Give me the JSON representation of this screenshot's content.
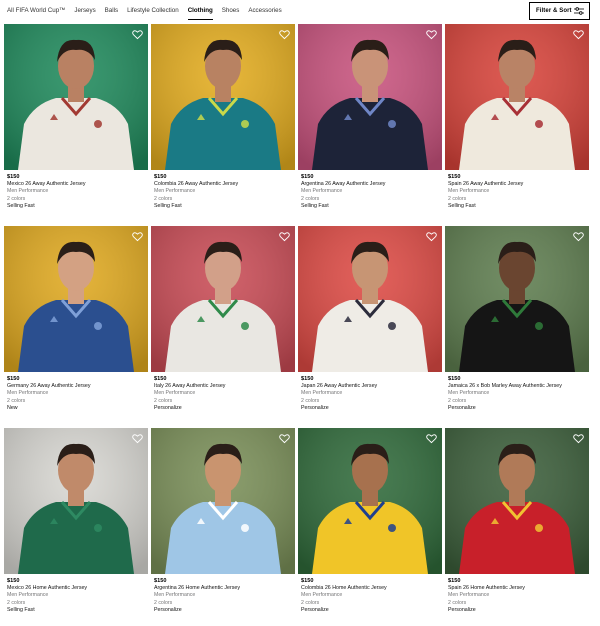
{
  "tabs": [
    {
      "label": "All FIFA World Cup™",
      "active": false
    },
    {
      "label": "Jerseys",
      "active": false
    },
    {
      "label": "Balls",
      "active": false
    },
    {
      "label": "Lifestyle Collection",
      "active": false
    },
    {
      "label": "Clothing",
      "active": true
    },
    {
      "label": "Shoes",
      "active": false
    },
    {
      "label": "Accessories",
      "active": false
    }
  ],
  "filter": {
    "label": "Filter & Sort",
    "icon": "sliders-icon"
  },
  "products": [
    {
      "price": "$150",
      "name": "Mexico 26 Away Authentic Jersey",
      "category": "Men Performance",
      "colors": "2 colors",
      "badge": "Selling Fast",
      "bg": "#1f8a5c",
      "shirt": "#ebe7df",
      "trim": "#a23a33",
      "skin": "#b98163"
    },
    {
      "price": "$150",
      "name": "Colombia 26 Away Authentic Jersey",
      "category": "Men Performance",
      "colors": "2 colors",
      "badge": "Selling Fast",
      "bg": "#e3ac1e",
      "shirt": "#1a7a85",
      "trim": "#c9d94a",
      "skin": "#b88262"
    },
    {
      "price": "$150",
      "name": "Argentina 26 Away Authentic Jersey",
      "category": "Men Performance",
      "colors": "2 colors",
      "badge": "Selling Fast",
      "bg": "#c8527d",
      "shirt": "#1d2338",
      "trim": "#6f86c6",
      "skin": "#c99378"
    },
    {
      "price": "$150",
      "name": "Spain 26 Away Authentic Jersey",
      "category": "Men Performance",
      "colors": "2 colors",
      "badge": "Selling Fast",
      "bg": "#d8433a",
      "shirt": "#efe9dd",
      "trim": "#a83036",
      "skin": "#b98366"
    },
    {
      "price": "$150",
      "name": "Germany 26 Away Authentic Jersey",
      "category": "Men Performance",
      "colors": "2 colors",
      "badge": "New",
      "bg": "#e0a91f",
      "shirt": "#2b4f8f",
      "trim": "#7fa0d8",
      "skin": "#d3a183"
    },
    {
      "price": "$150",
      "name": "Italy 26 Away Authentic Jersey",
      "category": "Men Performance",
      "colors": "2 colors",
      "badge": "Personalize",
      "bg": "#c94b55",
      "shirt": "#e9e7e2",
      "trim": "#2f8a4a",
      "skin": "#d2a089"
    },
    {
      "price": "$150",
      "name": "Japan 26 Away Authentic Jersey",
      "category": "Men Performance",
      "colors": "2 colors",
      "badge": "Personalize",
      "bg": "#de4a44",
      "shirt": "#efece6",
      "trim": "#2c2c3c",
      "skin": "#c79574"
    },
    {
      "price": "$150",
      "name": "Jamaica 26 x Bob Marley Away Authentic Jersey",
      "category": "Men Performance",
      "colors": "2 colors",
      "badge": "Personalize",
      "bg": "#5e7d4f",
      "shirt": "#151515",
      "trim": "#2f7a3a",
      "skin": "#6a4530"
    },
    {
      "price": "$150",
      "name": "Mexico 26 Home Authentic Jersey",
      "category": "Men Performance",
      "colors": "2 colors",
      "badge": "Selling Fast",
      "bg": "#d8d7d2",
      "shirt": "#1f6a4b",
      "trim": "#2e8a62",
      "skin": "#c08a6a"
    },
    {
      "price": "$150",
      "name": "Argentina 26 Home Authentic Jersey",
      "category": "Men Performance",
      "colors": "2 colors",
      "badge": "Personalize",
      "bg": "#7a8f58",
      "shirt": "#9fc6e6",
      "trim": "#ffffff",
      "skin": "#c9946f"
    },
    {
      "price": "$150",
      "name": "Colombia 26 Home Authentic Jersey",
      "category": "Men Performance",
      "colors": "2 colors",
      "badge": "Personalize",
      "bg": "#2f6a3a",
      "shirt": "#f0c528",
      "trim": "#1e3f8f",
      "skin": "#a7714e"
    },
    {
      "price": "$150",
      "name": "Spain 26 Home Authentic Jersey",
      "category": "Men Performance",
      "colors": "2 colors",
      "badge": "Personalize",
      "bg": "#3b5e3a",
      "shirt": "#c8202a",
      "trim": "#f1c232",
      "skin": "#b07a58"
    }
  ]
}
